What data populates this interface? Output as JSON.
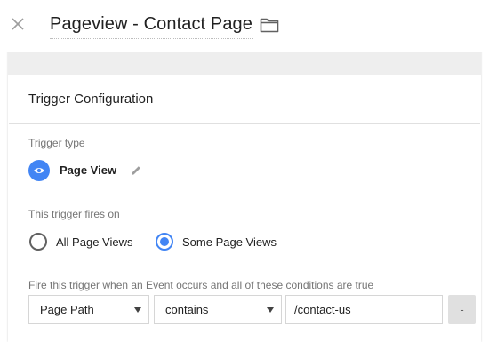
{
  "header": {
    "title": "Pageview - Contact Page",
    "close_icon": "close-icon",
    "folder_icon": "folder-icon"
  },
  "card": {
    "title": "Trigger Configuration",
    "trigger_type_label": "Trigger type",
    "trigger_type": {
      "icon": "eye-icon",
      "name": "Page View",
      "edit_icon": "pencil-icon"
    },
    "fires_on_label": "This trigger fires on",
    "fires_on_options": [
      {
        "label": "All Page Views",
        "checked": false
      },
      {
        "label": "Some Page Views",
        "checked": true
      }
    ],
    "condition_label": "Fire this trigger when an Event occurs and all of these conditions are true",
    "condition": {
      "variable": "Page Path",
      "operator": "contains",
      "value": "/contact-us",
      "remove_label": "-"
    }
  },
  "colors": {
    "accent": "#4285f4",
    "band": "#eeeeee",
    "divider": "#e0e0e0",
    "muted_text": "#757575"
  }
}
